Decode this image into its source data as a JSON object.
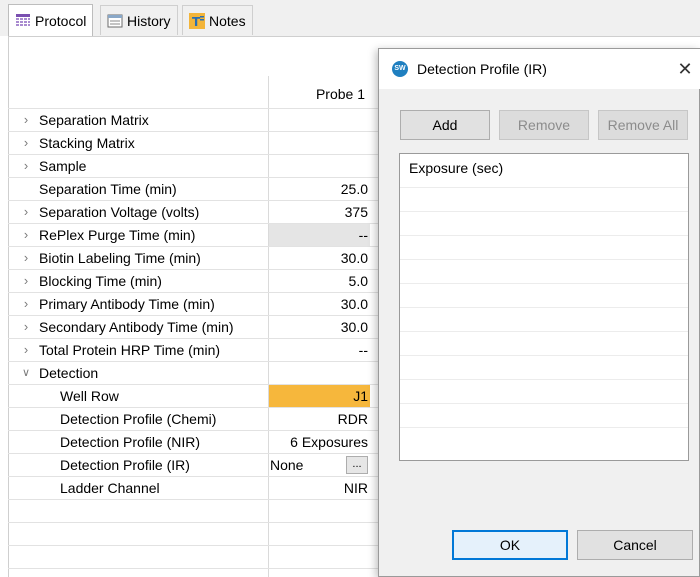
{
  "tabs": [
    {
      "label": "Protocol",
      "icon": "grid-table-icon",
      "active": true
    },
    {
      "label": "History",
      "icon": "history-log-icon",
      "active": false
    },
    {
      "label": "Notes",
      "icon": "notes-t-icon",
      "active": false
    }
  ],
  "table": {
    "column_header": "Probe 1",
    "rows": [
      {
        "label": "Separation Matrix",
        "expandable": true,
        "value": ""
      },
      {
        "label": "Stacking Matrix",
        "expandable": true,
        "value": ""
      },
      {
        "label": "Sample",
        "expandable": true,
        "value": ""
      },
      {
        "label": "Separation Time (min)",
        "expandable": false,
        "value": "25.0"
      },
      {
        "label": "Separation Voltage (volts)",
        "expandable": true,
        "value": "375"
      },
      {
        "label": "RePlex Purge Time (min)",
        "expandable": true,
        "value": "--"
      },
      {
        "label": "Biotin Labeling Time (min)",
        "expandable": true,
        "value": "30.0"
      },
      {
        "label": "Blocking Time (min)",
        "expandable": true,
        "value": "5.0"
      },
      {
        "label": "Primary Antibody Time (min)",
        "expandable": true,
        "value": "30.0"
      },
      {
        "label": "Secondary Antibody Time (min)",
        "expandable": true,
        "value": "30.0"
      },
      {
        "label": "Total Protein HRP Time (min)",
        "expandable": true,
        "value": "--"
      },
      {
        "label": "Detection",
        "expandable": true,
        "expanded": true,
        "value": ""
      },
      {
        "label": "Well Row",
        "value": "J1"
      },
      {
        "label": "Detection Profile (Chemi)",
        "value": "RDR"
      },
      {
        "label": "Detection Profile (NIR)",
        "value": "6 Exposures"
      },
      {
        "label": "Detection Profile (IR)",
        "value": "None",
        "button": "..."
      },
      {
        "label": "Ladder Channel",
        "value": "NIR"
      }
    ]
  },
  "dialog": {
    "title": "Detection Profile (IR)",
    "app_icon_text": "SW",
    "close_glyph": "✕",
    "buttons": {
      "add": "Add",
      "remove": "Remove",
      "remove_all": "Remove All",
      "ok": "OK",
      "cancel": "Cancel"
    },
    "list_header": "Exposure (sec)"
  },
  "colors": {
    "selected_cell": "#f6b73c",
    "disabled_cell": "#e5e5e5",
    "accent": "#0078d7"
  }
}
